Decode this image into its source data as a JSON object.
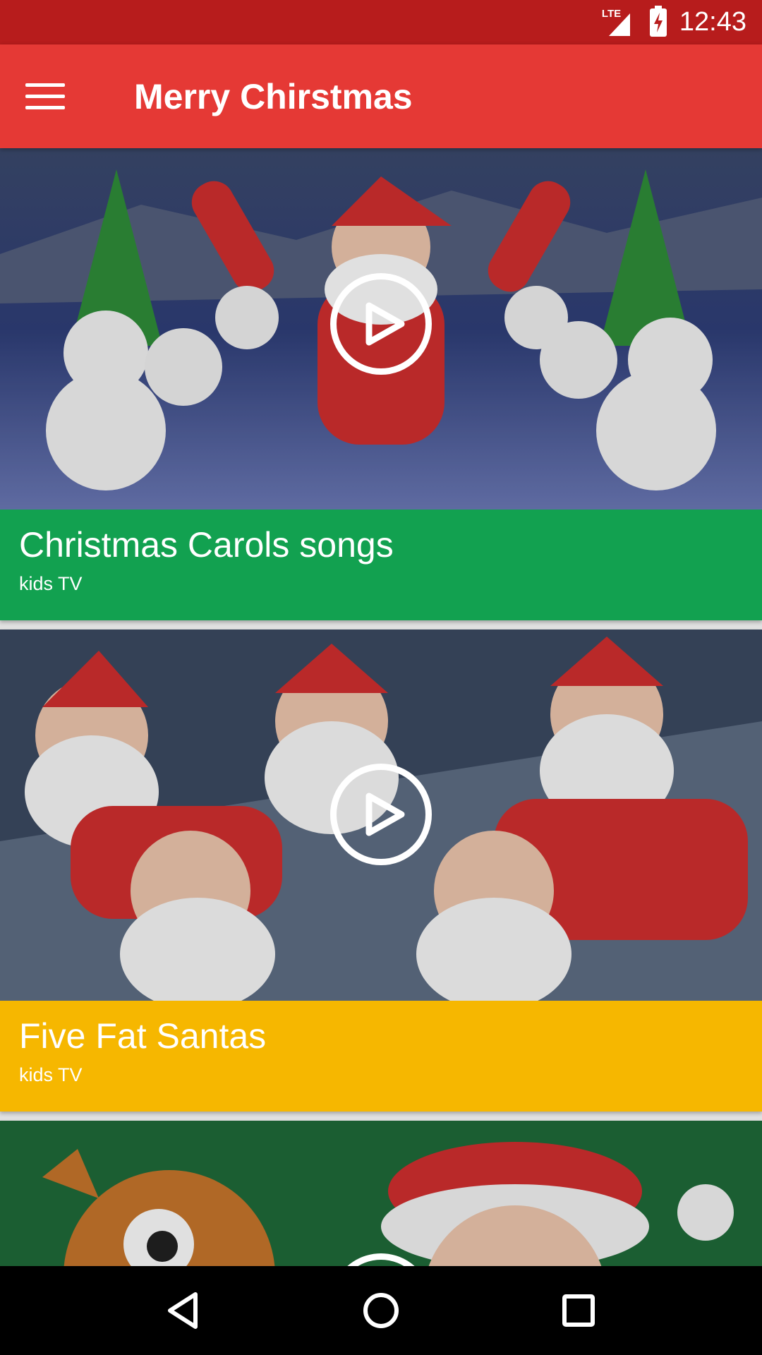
{
  "status_bar": {
    "network": "LTE",
    "time": "12:43"
  },
  "app_bar": {
    "title": "Merry Chirstmas",
    "color": "#e53935"
  },
  "videos": [
    {
      "title": "Christmas Carols songs",
      "channel": "kids TV",
      "caption_color": "#12a150"
    },
    {
      "title": "Five Fat Santas",
      "channel": "kids TV",
      "caption_color": "#f6b700"
    },
    {
      "title": "",
      "channel": "",
      "caption_color": ""
    }
  ],
  "icons": {
    "menu": "menu-icon",
    "play": "play-circle-icon",
    "back": "back-icon",
    "home": "home-icon",
    "recents": "recents-icon"
  }
}
